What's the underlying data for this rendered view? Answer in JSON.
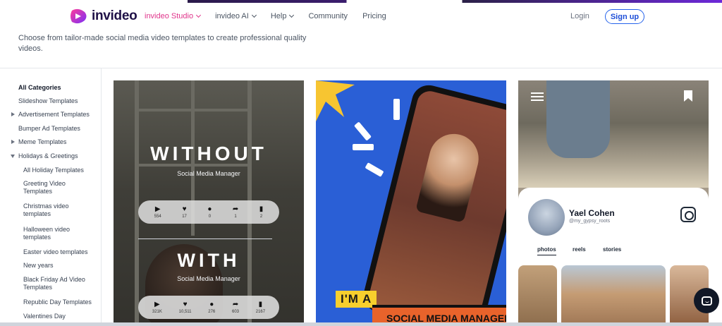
{
  "brand": {
    "name": "invideo",
    "accent": "#e0358b",
    "link_blue": "#2563eb"
  },
  "nav": [
    {
      "label": "invideo Studio",
      "dropdown": true,
      "active": true
    },
    {
      "label": "invideo AI",
      "dropdown": true,
      "active": false
    },
    {
      "label": "Help",
      "dropdown": true,
      "active": false
    },
    {
      "label": "Community",
      "dropdown": false,
      "active": false
    },
    {
      "label": "Pricing",
      "dropdown": false,
      "active": false
    }
  ],
  "auth": {
    "login": "Login",
    "signup": "Sign up"
  },
  "description": "Choose from tailor-made social media video templates to create professional quality videos.",
  "sidebar": {
    "items": [
      {
        "label": "All Categories",
        "bold": true
      },
      {
        "label": "Slideshow Templates"
      },
      {
        "label": "Advertisement Templates",
        "expandable": true
      },
      {
        "label": "Bumper Ad Templates"
      },
      {
        "label": "Meme Templates",
        "expandable": true
      },
      {
        "label": "Holidays & Greetings",
        "expanded": true
      },
      {
        "label": "All Holiday Templates",
        "sub": true
      },
      {
        "label": "Greeting Video Templates",
        "sub": true
      },
      {
        "label": "Christmas video templates",
        "sub": true
      },
      {
        "label": "Halloween video templates",
        "sub": true
      },
      {
        "label": "Easter video templates",
        "sub": true
      },
      {
        "label": "New years",
        "sub": true
      },
      {
        "label": "Black Friday Ad Video Templates",
        "sub": true
      },
      {
        "label": "Republic Day Templates",
        "sub": true
      },
      {
        "label": "Valentines Day",
        "sub": true
      }
    ]
  },
  "cards": {
    "card1": {
      "word1": "WITHOUT",
      "sub1": "Social Media Manager",
      "stats1": [
        "554",
        "17",
        "0",
        "1",
        "2"
      ],
      "word2": "WITH",
      "sub2": "Social Media Manager",
      "stats2": [
        "321K",
        "10,511",
        "276",
        "603",
        "2167"
      ]
    },
    "card2": {
      "tag": "I'M A",
      "ribbon": "SOCIAL MEDIA MANAGER"
    },
    "card3": {
      "name": "Yael Cohen",
      "handle": "@my_gypsy_roots",
      "tabs": [
        "photos",
        "reels",
        "stories"
      ]
    }
  },
  "icons": [
    "play-icon",
    "heart-icon",
    "comment-icon",
    "share-icon",
    "bookmark-icon",
    "instagram-icon",
    "menu-icon",
    "chat-icon"
  ]
}
